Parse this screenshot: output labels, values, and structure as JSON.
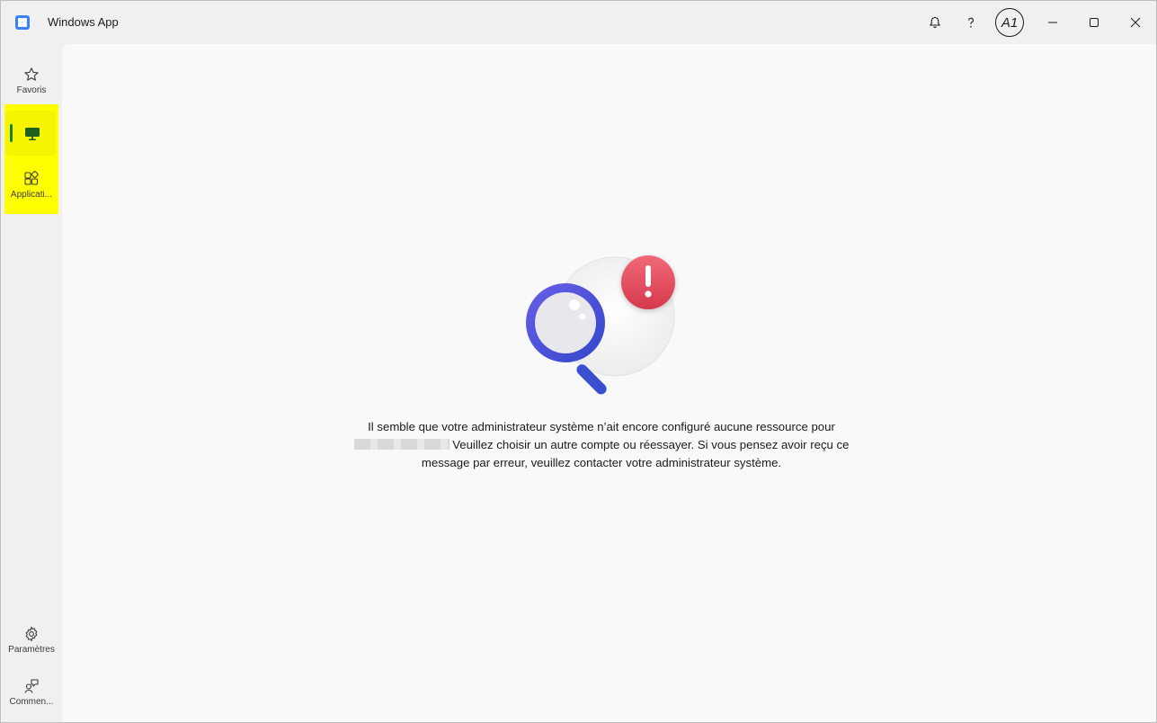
{
  "window": {
    "title": "Windows App"
  },
  "titlebar": {
    "avatar_initials": "A1",
    "icons": [
      "bell-icon",
      "help-icon",
      "minimize-icon",
      "maximize-icon",
      "close-icon"
    ]
  },
  "sidebar": {
    "items": [
      {
        "label": "Favoris",
        "icon": "star-icon"
      },
      {
        "label": "",
        "icon": "monitor-icon"
      },
      {
        "label": "Applicati...",
        "icon": "apps-icon"
      }
    ],
    "bottom": [
      {
        "label": "Paramètres",
        "icon": "gear-icon"
      },
      {
        "label": "Commen...",
        "icon": "feedback-icon"
      }
    ]
  },
  "main": {
    "message_part1": "Il semble que votre administrateur système n’ait encore configuré aucune ressource pour",
    "message_part2": "Veuillez choisir un autre compte ou réessayer. Si vous pensez avoir reçu ce message par erreur, veuillez contacter votre administrateur système.",
    "colors": {
      "magnifier": "#4f56d8",
      "alert": "#e0455a"
    }
  }
}
